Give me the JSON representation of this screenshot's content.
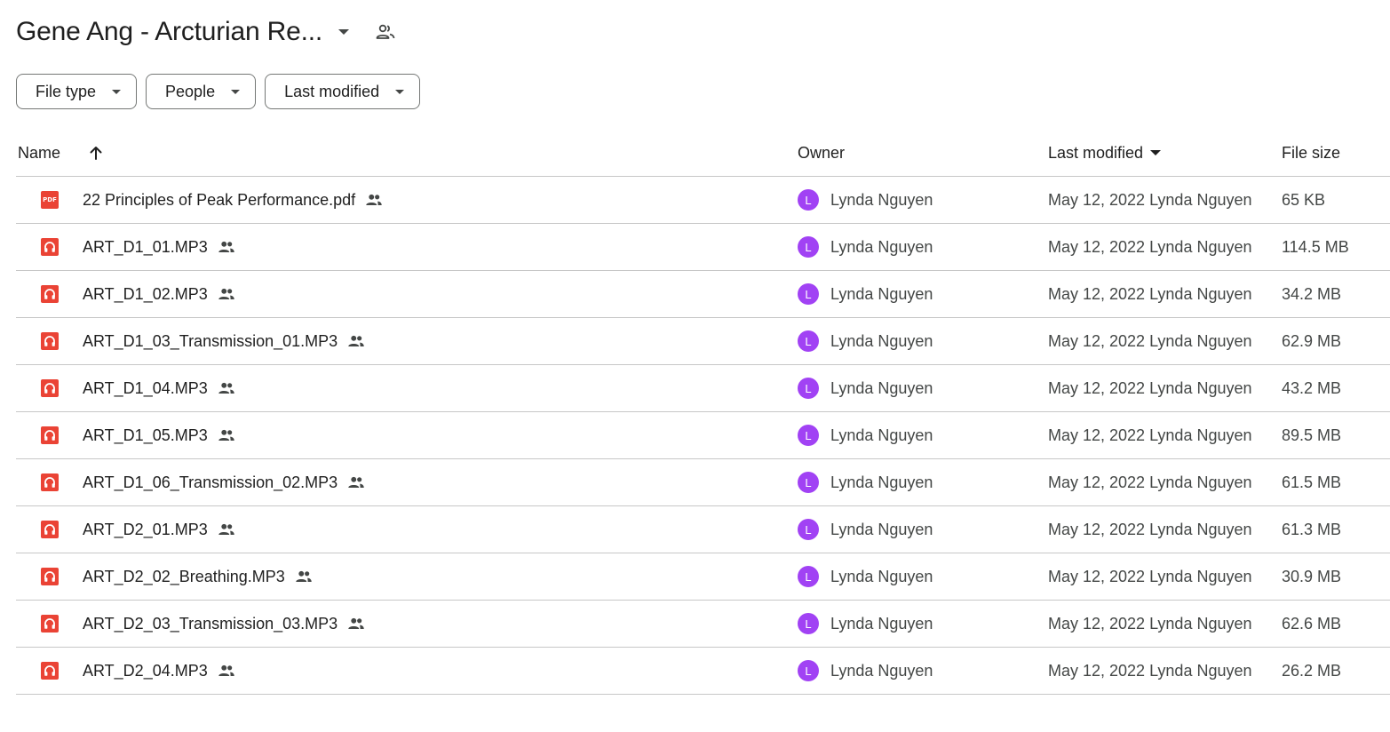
{
  "header": {
    "folder_title": "Gene Ang - Arcturian Re...",
    "dropdown_icon": "caret-down-icon",
    "share_icon": "people-outline-icon"
  },
  "filters": {
    "chips": [
      {
        "label": "File type"
      },
      {
        "label": "People"
      },
      {
        "label": "Last modified"
      }
    ]
  },
  "table": {
    "columns": {
      "name": "Name",
      "owner": "Owner",
      "last_modified": "Last modified",
      "file_size": "File size"
    },
    "sort_icon": "arrow-up-icon",
    "rows": [
      {
        "type": "pdf",
        "name": "22 Principles of Peak Performance.pdf",
        "owner_initial": "L",
        "owner": "Lynda Nguyen",
        "modified": "May 12, 2022 Lynda Nguyen",
        "size": "65 KB"
      },
      {
        "type": "audio",
        "name": "ART_D1_01.MP3",
        "owner_initial": "L",
        "owner": "Lynda Nguyen",
        "modified": "May 12, 2022 Lynda Nguyen",
        "size": "114.5 MB"
      },
      {
        "type": "audio",
        "name": "ART_D1_02.MP3",
        "owner_initial": "L",
        "owner": "Lynda Nguyen",
        "modified": "May 12, 2022 Lynda Nguyen",
        "size": "34.2 MB"
      },
      {
        "type": "audio",
        "name": "ART_D1_03_Transmission_01.MP3",
        "owner_initial": "L",
        "owner": "Lynda Nguyen",
        "modified": "May 12, 2022 Lynda Nguyen",
        "size": "62.9 MB"
      },
      {
        "type": "audio",
        "name": "ART_D1_04.MP3",
        "owner_initial": "L",
        "owner": "Lynda Nguyen",
        "modified": "May 12, 2022 Lynda Nguyen",
        "size": "43.2 MB"
      },
      {
        "type": "audio",
        "name": "ART_D1_05.MP3",
        "owner_initial": "L",
        "owner": "Lynda Nguyen",
        "modified": "May 12, 2022 Lynda Nguyen",
        "size": "89.5 MB"
      },
      {
        "type": "audio",
        "name": "ART_D1_06_Transmission_02.MP3",
        "owner_initial": "L",
        "owner": "Lynda Nguyen",
        "modified": "May 12, 2022 Lynda Nguyen",
        "size": "61.5 MB"
      },
      {
        "type": "audio",
        "name": "ART_D2_01.MP3",
        "owner_initial": "L",
        "owner": "Lynda Nguyen",
        "modified": "May 12, 2022 Lynda Nguyen",
        "size": "61.3 MB"
      },
      {
        "type": "audio",
        "name": "ART_D2_02_Breathing.MP3",
        "owner_initial": "L",
        "owner": "Lynda Nguyen",
        "modified": "May 12, 2022 Lynda Nguyen",
        "size": "30.9 MB"
      },
      {
        "type": "audio",
        "name": "ART_D2_03_Transmission_03.MP3",
        "owner_initial": "L",
        "owner": "Lynda Nguyen",
        "modified": "May 12, 2022 Lynda Nguyen",
        "size": "62.6 MB"
      },
      {
        "type": "audio",
        "name": "ART_D2_04.MP3",
        "owner_initial": "L",
        "owner": "Lynda Nguyen",
        "modified": "May 12, 2022 Lynda Nguyen",
        "size": "26.2 MB"
      }
    ]
  },
  "icons": {
    "pdf_label": "PDF",
    "pdf_icon": "pdf-file-icon",
    "audio_icon": "headphones-audio-file-icon",
    "shared_icon": "shared-people-icon"
  },
  "colors": {
    "file_icon_red": "#ea4335",
    "avatar_purple": "#a142f4",
    "divider": "#c7c7c7",
    "chip_border": "#747775"
  }
}
